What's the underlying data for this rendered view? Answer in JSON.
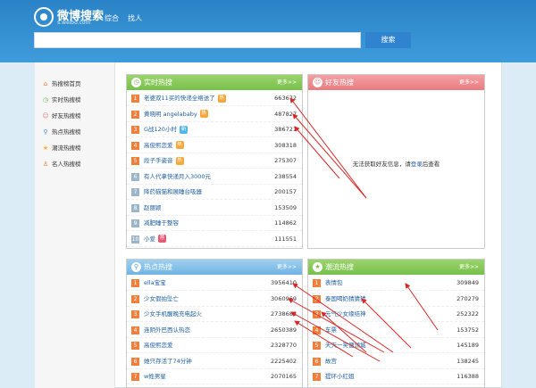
{
  "header": {
    "logo_title": "微博搜索",
    "logo_sub": "s.weibo.com",
    "nav": [
      "综合",
      "找人"
    ],
    "search_placeholder": "",
    "search_button": "搜索"
  },
  "sidebar": {
    "items": [
      {
        "icon": "home-icon",
        "glyph": "⌂",
        "label": "热搜榜首页"
      },
      {
        "icon": "clock-icon",
        "glyph": "◷",
        "label": "实时热搜榜"
      },
      {
        "icon": "friends-icon",
        "glyph": "☺",
        "label": "好友热搜榜"
      },
      {
        "icon": "search-icon",
        "glyph": "⚲",
        "label": "热点热搜榜"
      },
      {
        "icon": "star-icon",
        "glyph": "★",
        "label": "潮流热搜榜"
      },
      {
        "icon": "person-icon",
        "glyph": "♙",
        "label": "名人热搜榜"
      }
    ]
  },
  "realtime": {
    "title": "实时热搜",
    "more": "更多>>",
    "rows": [
      {
        "rank": "1",
        "text": "老婆双11买的快递全络送了",
        "badge": "热",
        "value": "663672"
      },
      {
        "rank": "2",
        "text": "黄晓明 angelababy",
        "badge": "热",
        "value": "487827"
      },
      {
        "rank": "3",
        "text": "G战120小时",
        "badge": "新",
        "value": "386721"
      },
      {
        "rank": "4",
        "text": "高俊熙恋爱",
        "badge": "热",
        "value": "308318"
      },
      {
        "rank": "5",
        "text": "段子手姿音",
        "badge": "热",
        "value": "275307"
      },
      {
        "rank": "6",
        "text": "有人代拿快递月入3000元",
        "badge": "",
        "value": "238554"
      },
      {
        "rank": "7",
        "text": "降药猫猫和展睡台吸器",
        "badge": "",
        "value": "200157"
      },
      {
        "rank": "8",
        "text": "赵丽颖",
        "badge": "",
        "value": "153509"
      },
      {
        "rank": "9",
        "text": "减肥睡于整容",
        "badge": "",
        "value": "114862"
      },
      {
        "rank": "10",
        "text": "小爱",
        "badge": "荐",
        "value": "111551"
      }
    ]
  },
  "friends": {
    "title": "好友热搜",
    "more": "更多>>",
    "empty_prefix": "无法获取好友信息，请",
    "empty_link": "登录",
    "empty_suffix": "后查看"
  },
  "hotspot": {
    "title": "热点热搜",
    "more": "更多>>",
    "rows": [
      {
        "rank": "1",
        "text": "ella宝宝",
        "value": "3956410"
      },
      {
        "rank": "2",
        "text": "少女假拍坠亡",
        "value": "3060969"
      },
      {
        "rank": "3",
        "text": "少女手机醒晚充电起火",
        "value": "2738683"
      },
      {
        "rank": "4",
        "text": "连阴外巴西认热恋",
        "value": "2650389"
      },
      {
        "rank": "5",
        "text": "高俊熙恋爱",
        "value": "2328770"
      },
      {
        "rank": "6",
        "text": "她只存活了74分钟",
        "value": "2225402"
      },
      {
        "rank": "7",
        "text": "w姓男星",
        "value": "2070165"
      }
    ]
  },
  "trend": {
    "title": "潮流热搜",
    "more": "更多>>",
    "rows": [
      {
        "rank": "1",
        "text": "表情包",
        "value": "309849"
      },
      {
        "rank": "2",
        "text": "泰国喝奶猜猜猜",
        "value": "270279"
      },
      {
        "rank": "3",
        "text": "元气少女缘结神",
        "value": "252322"
      },
      {
        "rank": "4",
        "text": "车票",
        "value": "153752"
      },
      {
        "rank": "5",
        "text": "天天一笑便领城",
        "value": "145189"
      },
      {
        "rank": "6",
        "text": "故宫",
        "value": "138245"
      },
      {
        "rank": "7",
        "text": "提环小红姐",
        "value": "116388"
      }
    ]
  }
}
